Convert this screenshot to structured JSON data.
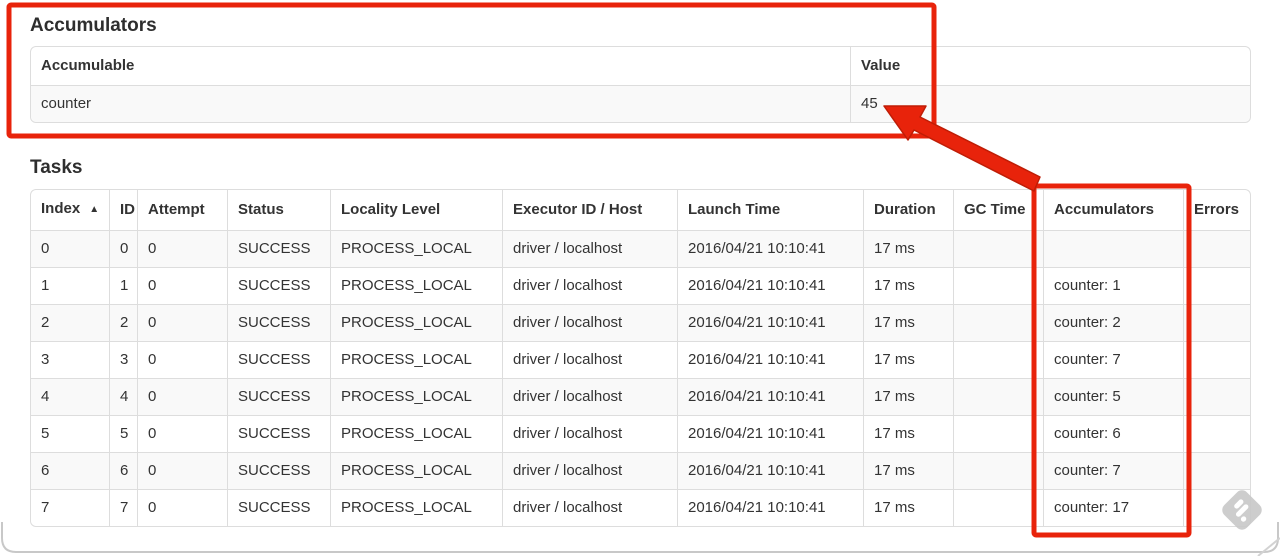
{
  "colors": {
    "annotation_red": "#e8230b",
    "annotation_red_outline": "#bf1d06",
    "table_border": "#dddddd",
    "row_stripe": "#f9f9f9",
    "text": "#333333",
    "watermark_gray": "#c9c9c9"
  },
  "accumulators_section": {
    "heading": "Accumulators",
    "columns": {
      "accumulable": "Accumulable",
      "value": "Value"
    },
    "rows": [
      {
        "accumulable": "counter",
        "value": "45"
      }
    ]
  },
  "tasks_section": {
    "heading": "Tasks",
    "sort_indicator": "▲",
    "columns": [
      "Index",
      "ID",
      "Attempt",
      "Status",
      "Locality Level",
      "Executor ID / Host",
      "Launch Time",
      "Duration",
      "GC Time",
      "Accumulators",
      "Errors"
    ],
    "rows": [
      [
        "0",
        "0",
        "0",
        "SUCCESS",
        "PROCESS_LOCAL",
        "driver / localhost",
        "2016/04/21 10:10:41",
        "17 ms",
        "",
        "",
        ""
      ],
      [
        "1",
        "1",
        "0",
        "SUCCESS",
        "PROCESS_LOCAL",
        "driver / localhost",
        "2016/04/21 10:10:41",
        "17 ms",
        "",
        "counter: 1",
        ""
      ],
      [
        "2",
        "2",
        "0",
        "SUCCESS",
        "PROCESS_LOCAL",
        "driver / localhost",
        "2016/04/21 10:10:41",
        "17 ms",
        "",
        "counter: 2",
        ""
      ],
      [
        "3",
        "3",
        "0",
        "SUCCESS",
        "PROCESS_LOCAL",
        "driver / localhost",
        "2016/04/21 10:10:41",
        "17 ms",
        "",
        "counter: 7",
        ""
      ],
      [
        "4",
        "4",
        "0",
        "SUCCESS",
        "PROCESS_LOCAL",
        "driver / localhost",
        "2016/04/21 10:10:41",
        "17 ms",
        "",
        "counter: 5",
        ""
      ],
      [
        "5",
        "5",
        "0",
        "SUCCESS",
        "PROCESS_LOCAL",
        "driver / localhost",
        "2016/04/21 10:10:41",
        "17 ms",
        "",
        "counter: 6",
        ""
      ],
      [
        "6",
        "6",
        "0",
        "SUCCESS",
        "PROCESS_LOCAL",
        "driver / localhost",
        "2016/04/21 10:10:41",
        "17 ms",
        "",
        "counter: 7",
        ""
      ],
      [
        "7",
        "7",
        "0",
        "SUCCESS",
        "PROCESS_LOCAL",
        "driver / localhost",
        "2016/04/21 10:10:41",
        "17 ms",
        "",
        "counter: 17",
        ""
      ]
    ]
  }
}
